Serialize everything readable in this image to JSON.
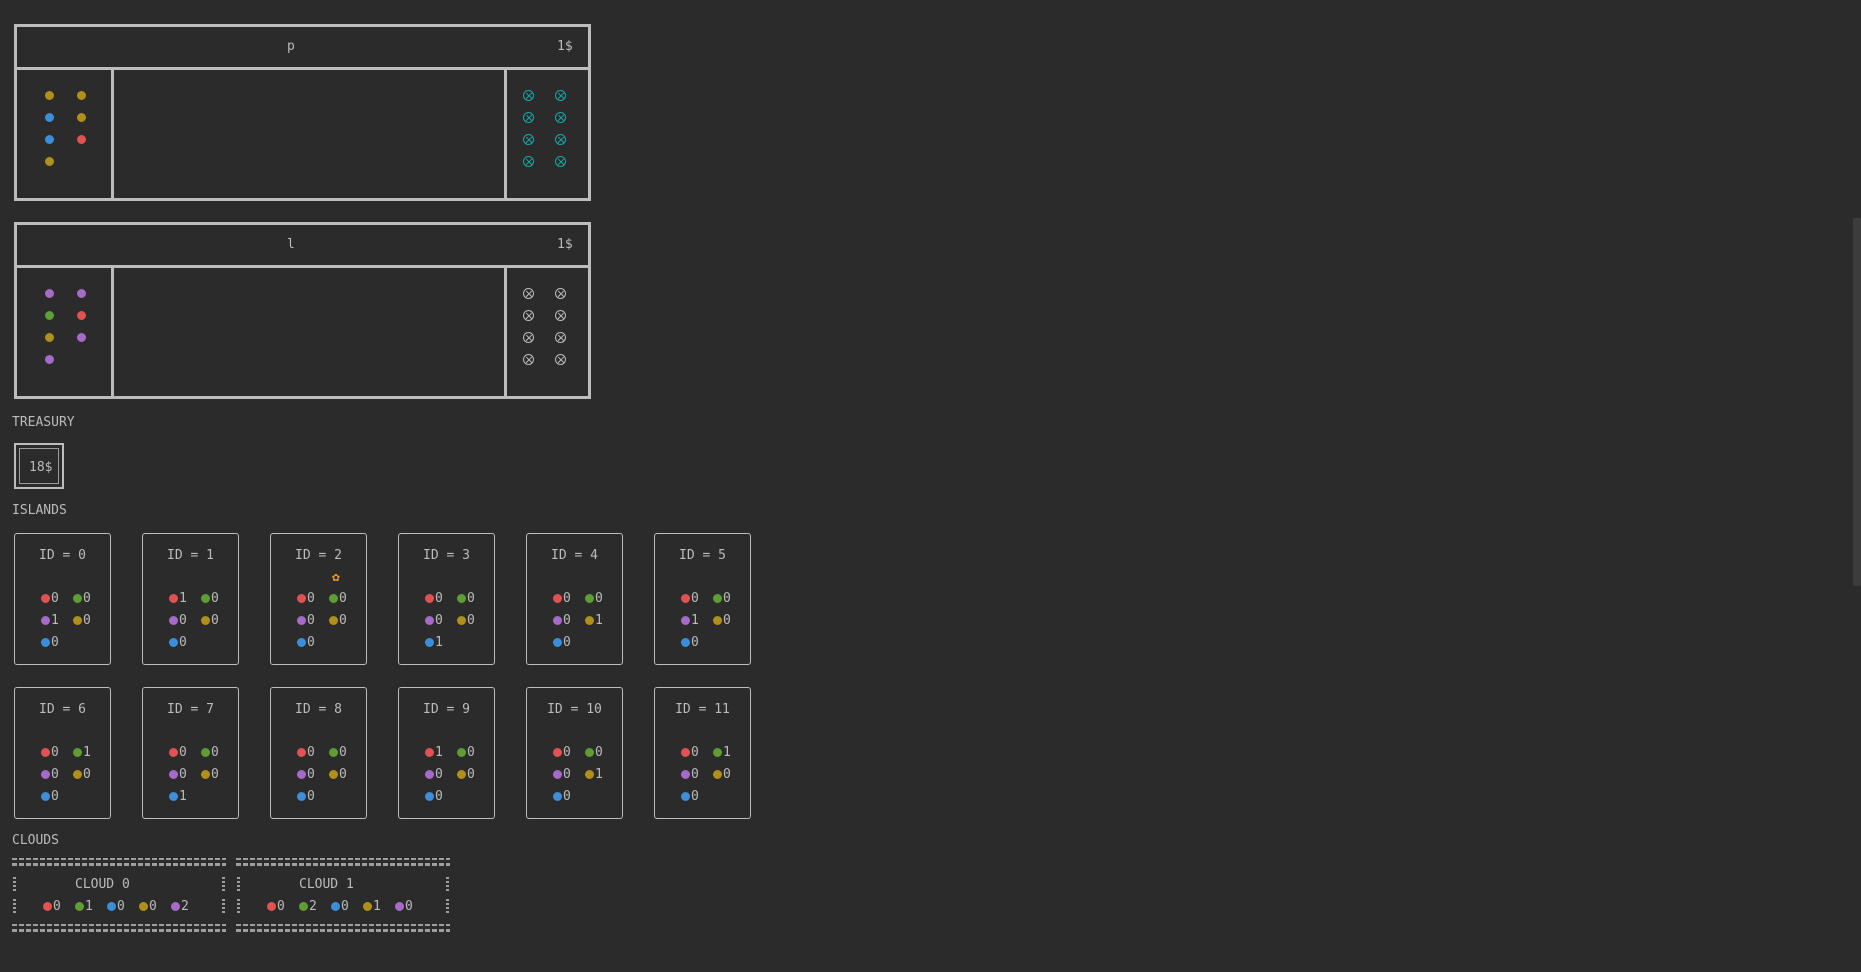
{
  "colors": {
    "red": "#e35252",
    "green": "#5e9e35",
    "blue": "#3d8ed8",
    "yellow": "#b0901a",
    "pink": "#a56bc8",
    "tower_teal": "#1aa7a0",
    "tower_grey": "#bbbbbb",
    "mother_nature": "#f0a020"
  },
  "players": [
    {
      "name": "p",
      "coins": "1$",
      "entrance": [
        "yellow",
        "yellow",
        "blue",
        "yellow",
        "blue",
        "red",
        "yellow"
      ],
      "tower_color": "tower_teal",
      "towers": 8
    },
    {
      "name": "l",
      "coins": "1$",
      "entrance": [
        "pink",
        "pink",
        "green",
        "red",
        "yellow",
        "pink",
        "pink"
      ],
      "tower_color": "tower_grey",
      "towers": 8
    }
  ],
  "treasury": {
    "label": "TREASURY",
    "value": "18$"
  },
  "islands_label": "ISLANDS",
  "islands": [
    {
      "title": "ID = 0",
      "red": "0",
      "green": "0",
      "pink": "1",
      "yellow": "0",
      "blue": "0",
      "mother_nature": false
    },
    {
      "title": "ID = 1",
      "red": "1",
      "green": "0",
      "pink": "0",
      "yellow": "0",
      "blue": "0",
      "mother_nature": false
    },
    {
      "title": "ID = 2",
      "red": "0",
      "green": "0",
      "pink": "0",
      "yellow": "0",
      "blue": "0",
      "mother_nature": true
    },
    {
      "title": "ID = 3",
      "red": "0",
      "green": "0",
      "pink": "0",
      "yellow": "0",
      "blue": "1",
      "mother_nature": false
    },
    {
      "title": "ID = 4",
      "red": "0",
      "green": "0",
      "pink": "0",
      "yellow": "1",
      "blue": "0",
      "mother_nature": false
    },
    {
      "title": "ID = 5",
      "red": "0",
      "green": "0",
      "pink": "1",
      "yellow": "0",
      "blue": "0",
      "mother_nature": false
    },
    {
      "title": "ID = 6",
      "red": "0",
      "green": "1",
      "pink": "0",
      "yellow": "0",
      "blue": "0",
      "mother_nature": false
    },
    {
      "title": "ID = 7",
      "red": "0",
      "green": "0",
      "pink": "0",
      "yellow": "0",
      "blue": "1",
      "mother_nature": false
    },
    {
      "title": "ID = 8",
      "red": "0",
      "green": "0",
      "pink": "0",
      "yellow": "0",
      "blue": "0",
      "mother_nature": false
    },
    {
      "title": "ID = 9",
      "red": "1",
      "green": "0",
      "pink": "0",
      "yellow": "0",
      "blue": "0",
      "mother_nature": false
    },
    {
      "title": "ID = 10",
      "red": "0",
      "green": "0",
      "pink": "0",
      "yellow": "1",
      "blue": "0",
      "mother_nature": false
    },
    {
      "title": "ID = 11",
      "red": "0",
      "green": "1",
      "pink": "0",
      "yellow": "0",
      "blue": "0",
      "mother_nature": false
    }
  ],
  "mother_nature_glyph": "✿",
  "clouds_label": "CLOUDS",
  "clouds": [
    {
      "title": "CLOUD 0",
      "red": "0",
      "green": "1",
      "blue": "0",
      "yellow": "0",
      "pink": "2"
    },
    {
      "title": "CLOUD 1",
      "red": "0",
      "green": "2",
      "blue": "0",
      "yellow": "1",
      "pink": "0"
    }
  ]
}
